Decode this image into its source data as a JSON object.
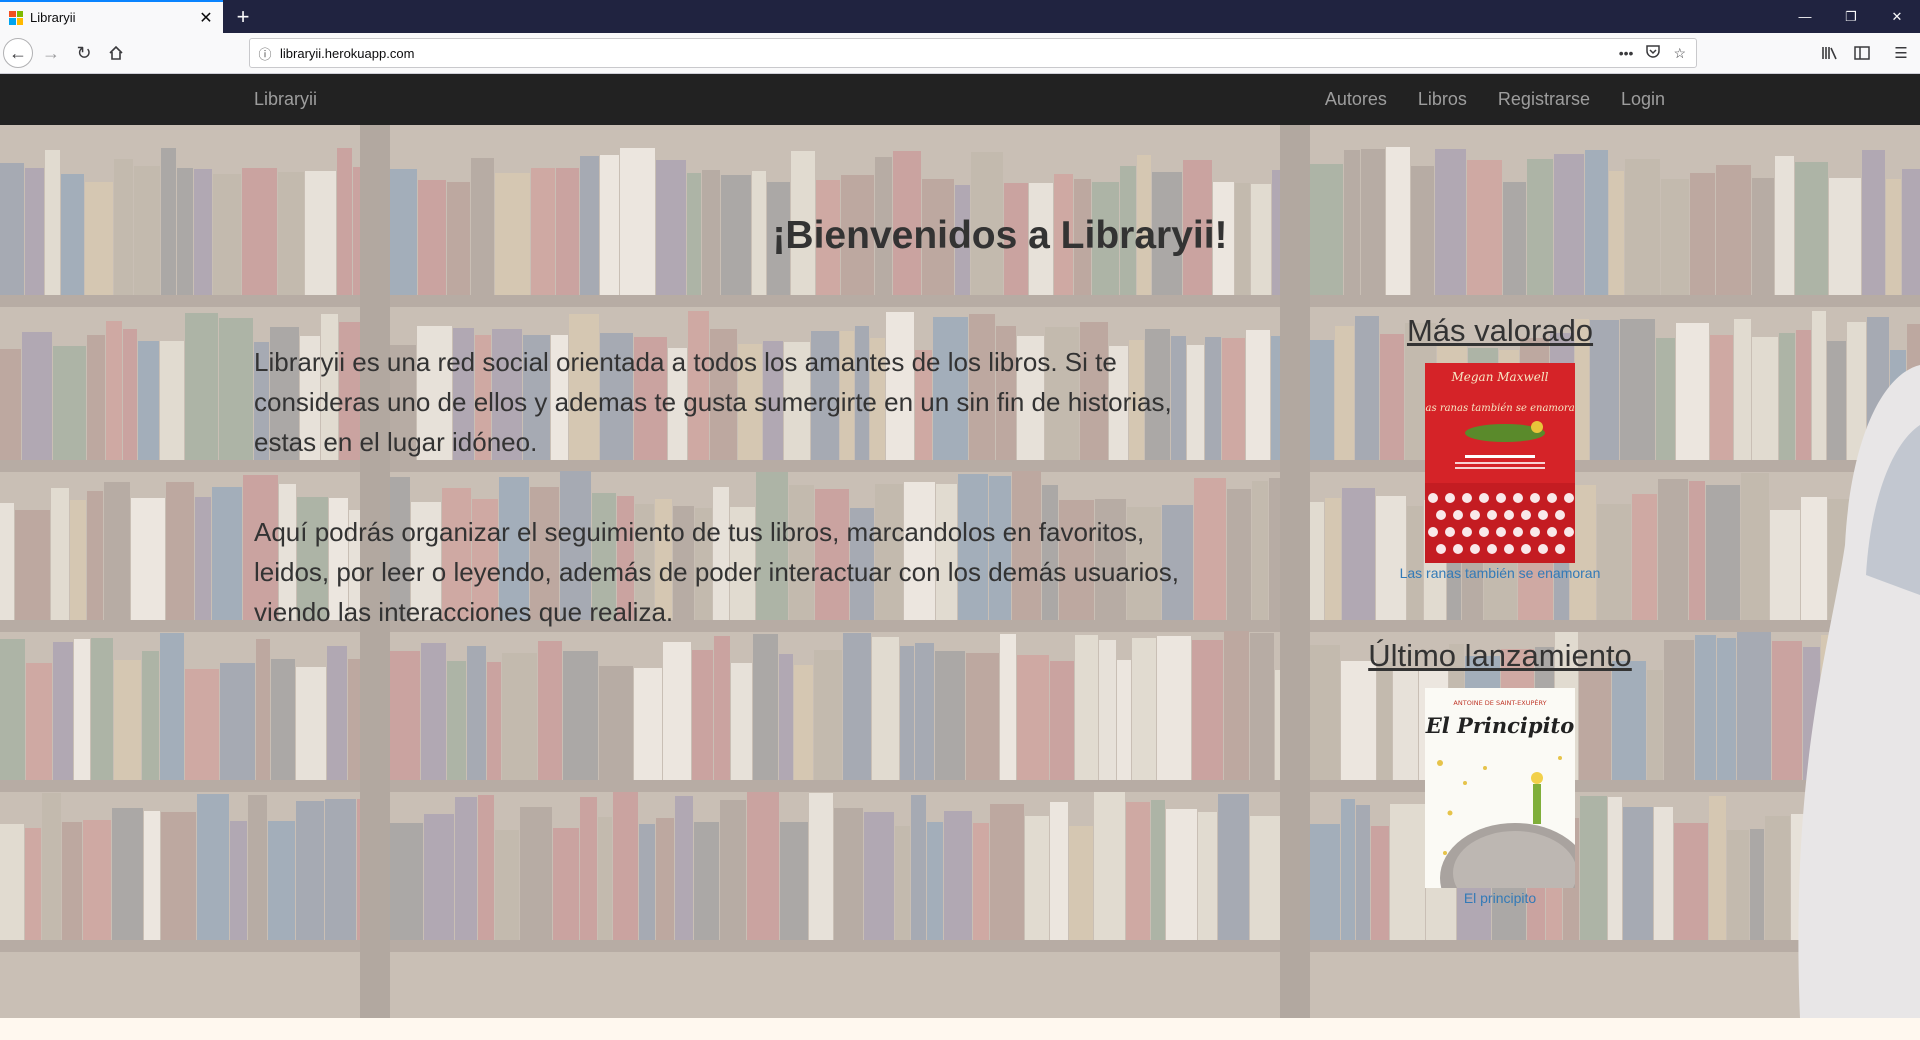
{
  "browser": {
    "tab_title": "Libraryii",
    "new_tab": "+",
    "url": "libraryii.herokuapp.com",
    "icons": [
      "back-icon",
      "forward-icon",
      "reload-icon",
      "home-icon",
      "info-icon",
      "more-icon",
      "pocket-icon",
      "bookmark-star-icon",
      "library-icon",
      "sidebar-icon",
      "menu-icon"
    ]
  },
  "site": {
    "brand": "Libraryii",
    "nav": [
      "Autores",
      "Libros",
      "Registrarse",
      "Login"
    ],
    "title": "¡Bienvenidos a Libraryii!",
    "paragraphs": [
      "Libraryii es una red social orientada a todos los amantes de los libros. Si te consideras uno de ellos y ademas te gusta sumergirte en un sin fin de historias, estas en el lugar idóneo.",
      "Aquí podrás organizar el seguimiento de tus libros, marcandolos en favoritos, leidos, por leer o leyendo, además de poder interactuar con los demás usuarios, viendo las interacciones que realiza."
    ],
    "top_rated": {
      "heading": "Más valorado",
      "book_title": "Las ranas también se enamoran",
      "cover_author": "Megan Maxwell",
      "cover_title": "Las ranas también se enamoran"
    },
    "latest": {
      "heading": "Último lanzamiento",
      "book_title": "El principito",
      "cover_author": "ANTOINE DE SAINT-EXUPÉRY",
      "cover_title": "El Principito"
    }
  },
  "colors": {
    "navbar": "#222222",
    "nav_text": "#9d9d9d",
    "link": "#337ab7",
    "tab_bar": "#202340"
  }
}
